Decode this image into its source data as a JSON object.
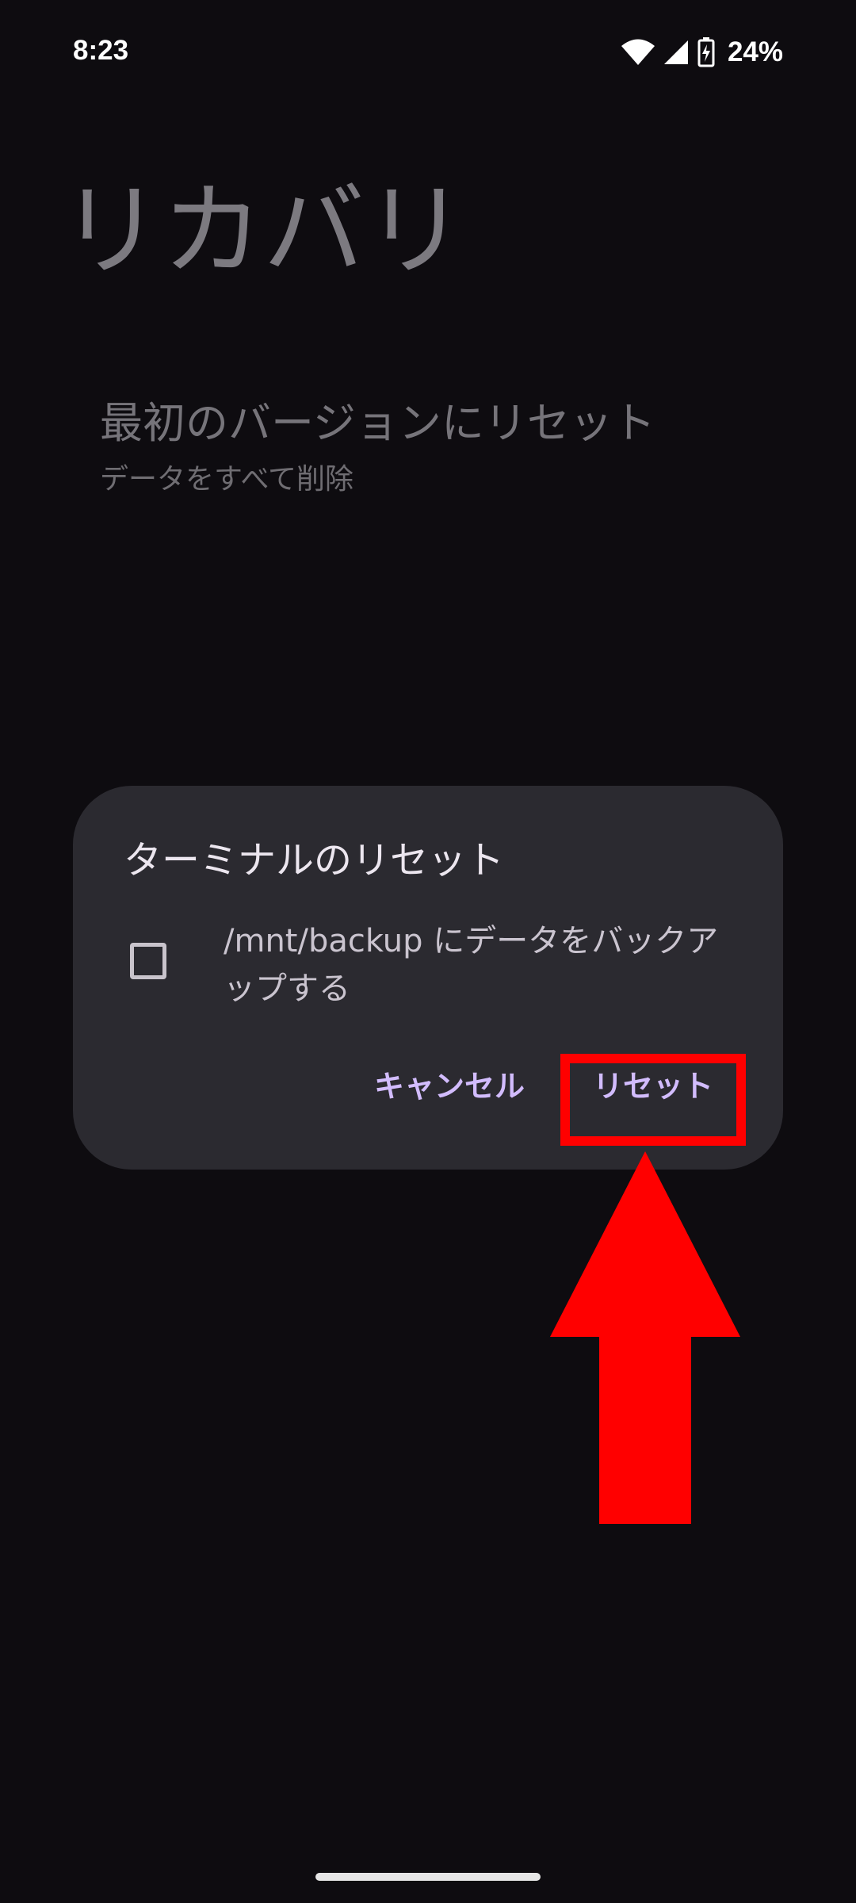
{
  "status_bar": {
    "time": "8:23",
    "battery_percent": "24%",
    "icons": [
      "wifi-icon",
      "cell-signal-icon",
      "battery-charging-icon"
    ]
  },
  "page": {
    "title": "リカバリ",
    "item": {
      "title": "最初のバージョンにリセット",
      "summary": "データをすべて削除"
    }
  },
  "dialog": {
    "title": "ターミナルのリセット",
    "checkbox_label": "/mnt/backup にデータをバックアップする",
    "checkbox_checked": false,
    "cancel_label": "キャンセル",
    "reset_label": "リセット"
  },
  "colors": {
    "background": "#0e0c10",
    "dialog_surface": "#2b2a30",
    "accent": "#d2bcfd",
    "annotation": "#ff0000"
  }
}
